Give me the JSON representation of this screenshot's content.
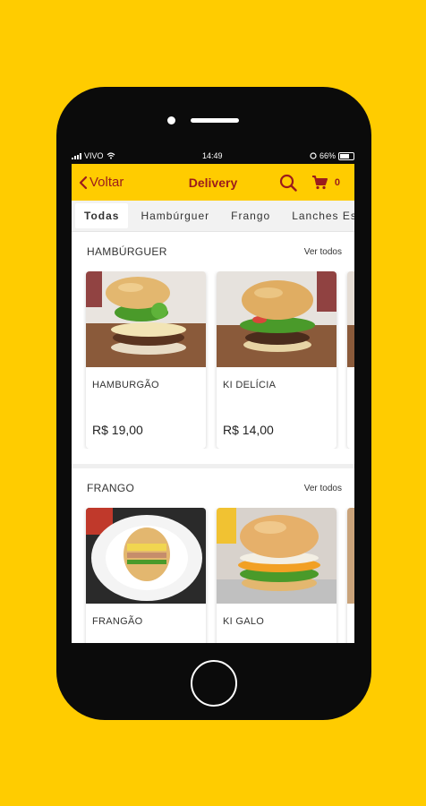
{
  "status": {
    "carrier": "VIVO",
    "time": "14:49",
    "battery": "66%"
  },
  "header": {
    "back_label": "Voltar",
    "title": "Delivery",
    "cart_count": "0"
  },
  "tabs": [
    {
      "label": "Todas"
    },
    {
      "label": "Hambúrguer"
    },
    {
      "label": "Frango"
    },
    {
      "label": "Lanches Es"
    }
  ],
  "sections": [
    {
      "title": "HAMBÚRGUER",
      "see_all": "Ver todos",
      "items": [
        {
          "name": "HAMBURGÃO",
          "price": "R$ 19,00"
        },
        {
          "name": "KI DELÍCIA",
          "price": "R$ 14,00"
        }
      ]
    },
    {
      "title": "FRANGO",
      "see_all": "Ver todos",
      "items": [
        {
          "name": "FRANGÃO"
        },
        {
          "name": "KI GALO"
        }
      ]
    }
  ],
  "colors": {
    "brand_yellow": "#FFCC00",
    "brand_red": "#9B1C1C"
  }
}
